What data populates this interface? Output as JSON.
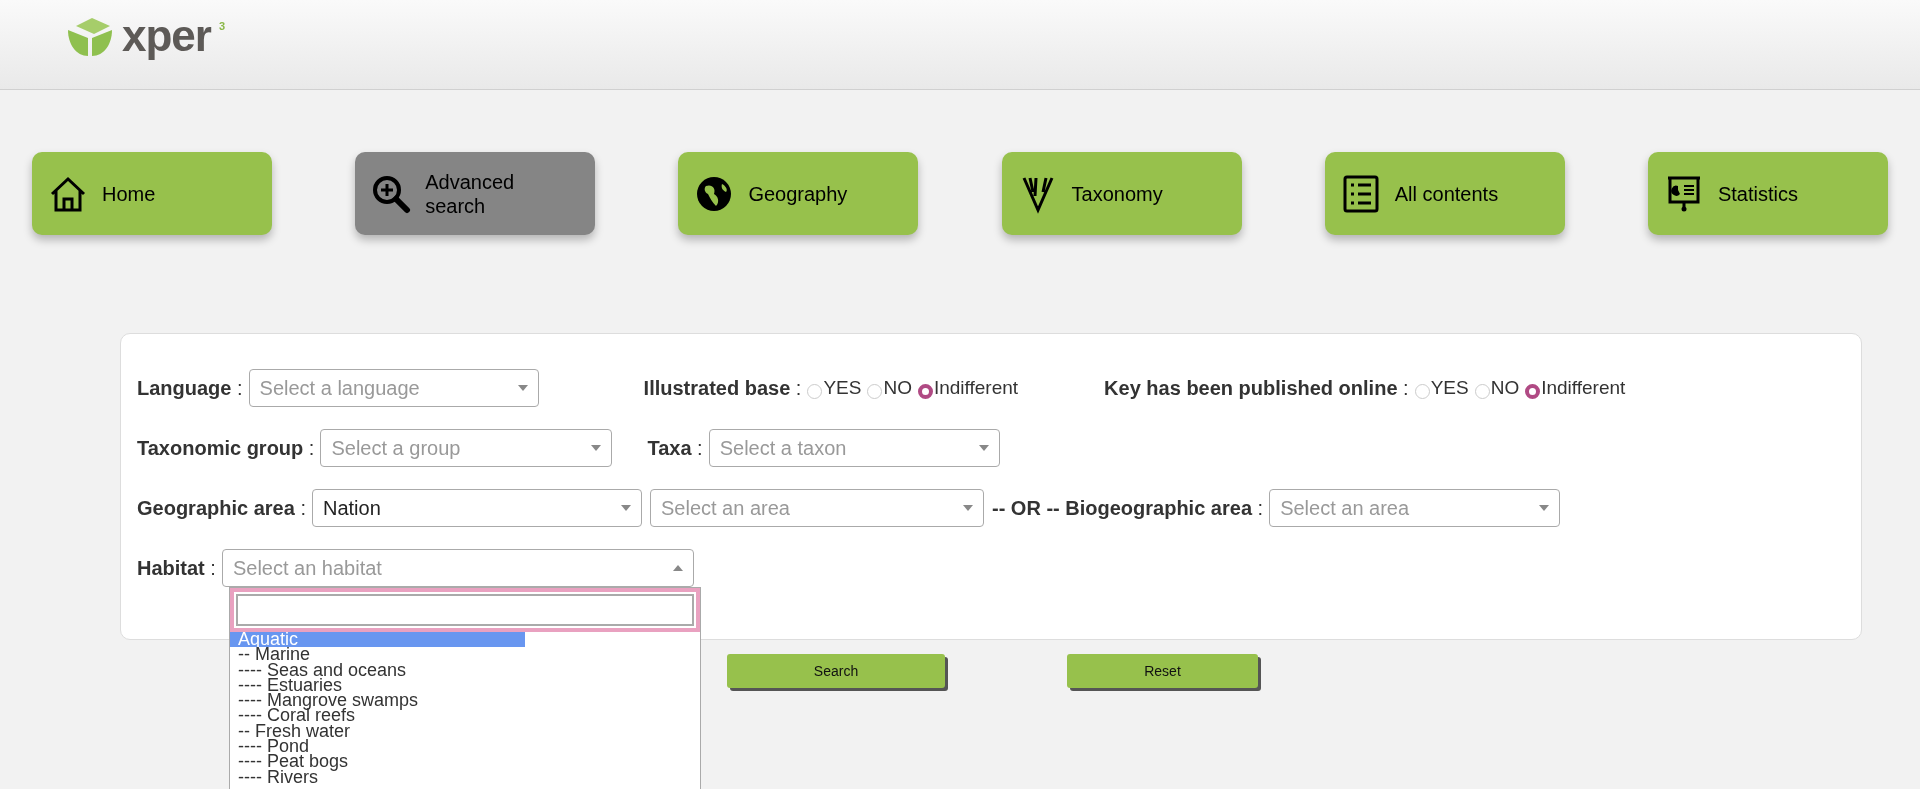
{
  "header": {
    "logo_text": "xper",
    "logo_superscript": "3"
  },
  "nav": [
    {
      "label": "Home",
      "selected": false
    },
    {
      "label": "Advanced search",
      "selected": true
    },
    {
      "label": "Geography",
      "selected": false
    },
    {
      "label": "Taxonomy",
      "selected": false
    },
    {
      "label": "All contents",
      "selected": false
    },
    {
      "label": "Statistics",
      "selected": false
    }
  ],
  "form": {
    "rows": [
      [
        {
          "kind": "select",
          "label": "**Language** :",
          "placeholder": "Select a language"
        },
        {
          "kind": "radio",
          "label": "**Illustrated base** :",
          "options": [
            {
              "label": "YES",
              "selected": false
            },
            {
              "label": "NO",
              "selected": false
            },
            {
              "label": "Indifferent",
              "selected": true
            }
          ]
        },
        {
          "kind": "radio",
          "label": "**Key has been published online** :",
          "options": [
            {
              "label": "YES",
              "selected": false
            },
            {
              "label": "NO",
              "selected": false
            },
            {
              "label": "Indifferent",
              "selected": true
            }
          ]
        }
      ],
      [
        {
          "kind": "select",
          "label": "**Taxonomic group** :",
          "placeholder": "Select a group"
        },
        {
          "kind": "select",
          "label": "**Taxa** :",
          "placeholder": "Select a taxon"
        }
      ],
      [
        {
          "kind": "select",
          "label": "**Geographic area** :",
          "value": "Nation"
        },
        {
          "kind": "select",
          "placeholder": "Select an area"
        },
        {
          "kind": "select",
          "label": "**-- OR -- Biogeographic area** :",
          "placeholder": "Select an area"
        }
      ],
      [
        {
          "kind": "select",
          "label": "**Habitat** :",
          "placeholder": "Select an habitat",
          "expanded": true
        }
      ]
    ]
  },
  "dropdown": {
    "options": [
      {
        "label": "Aquatic",
        "selected": true
      },
      {
        "label": "-- Marine",
        "selected": false
      },
      {
        "label": "---- Seas and oceans",
        "selected": false
      },
      {
        "label": "---- Estuaries",
        "selected": false
      },
      {
        "label": "---- Mangrove swamps",
        "selected": false
      },
      {
        "label": "---- Coral reefs",
        "selected": false
      },
      {
        "label": "-- Fresh water",
        "selected": false
      },
      {
        "label": "---- Pond",
        "selected": false
      },
      {
        "label": "---- Peat bogs",
        "selected": false
      },
      {
        "label": "---- Rivers",
        "selected": false
      }
    ]
  },
  "buttons": [
    "Search",
    "Reset"
  ]
}
